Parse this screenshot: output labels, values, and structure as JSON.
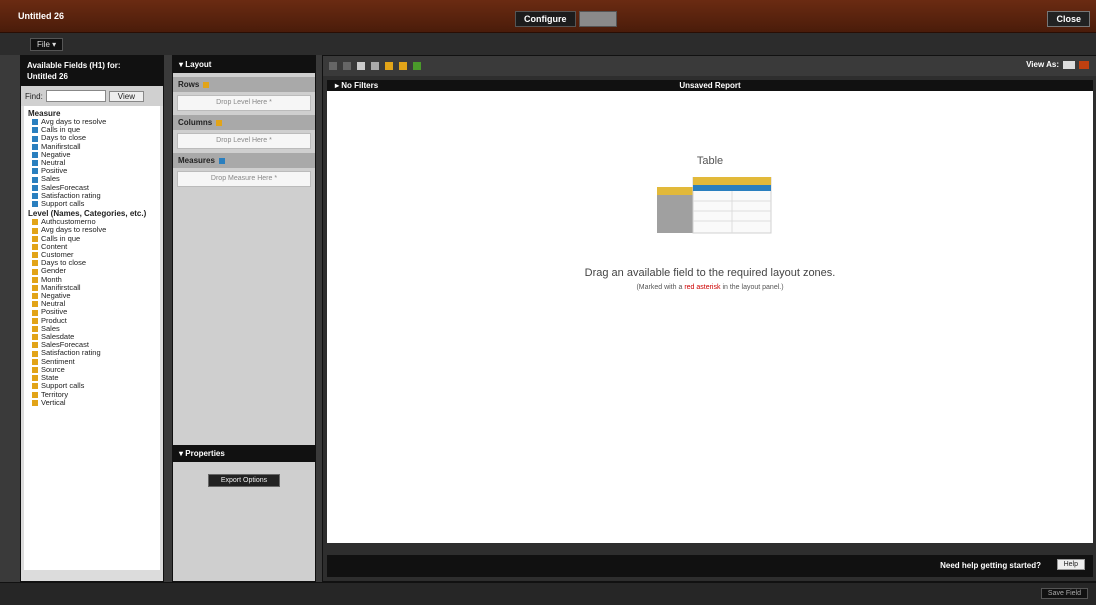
{
  "window": {
    "title": "Untitled 26",
    "close_label": "Close"
  },
  "mode_tabs": [
    {
      "label": "Configure"
    },
    {
      "label": ""
    }
  ],
  "file_button": "File ▾",
  "fields_panel": {
    "header_line1": "Available Fields (H1) for:",
    "header_line2": "Untitled 26",
    "find_label": "Find:",
    "find_placeholder": "",
    "view_label": "View",
    "groups": [
      {
        "name": "Measure",
        "icon": "measure-icon",
        "items": [
          "Avg days to resolve",
          "Calls in que",
          "Days to close",
          "Manifirstcall",
          "Negative",
          "Neutral",
          "Positive",
          "Sales",
          "SalesForecast",
          "Satisfaction rating",
          "Support calls"
        ]
      },
      {
        "name": "Level (Names, Categories, etc.)",
        "icon": "level-icon",
        "items": [
          "Authcustomerno",
          "Avg days to resolve",
          "Calls in que",
          "Content",
          "Customer",
          "Days to close",
          "Gender",
          "Month",
          "Manifirstcall",
          "Negative",
          "Neutral",
          "Positive",
          "Product",
          "Sales",
          "Salesdate",
          "SalesForecast",
          "Satisfaction rating",
          "Sentiment",
          "Source",
          "State",
          "Support calls",
          "Territory",
          "Vertical"
        ]
      }
    ]
  },
  "layout_panel": {
    "title": "Layout",
    "zones": [
      {
        "label": "Rows",
        "placeholder": "Drop Level Here *"
      },
      {
        "label": "Columns",
        "placeholder": "Drop Level Here *"
      },
      {
        "label": "Measures",
        "placeholder": "Drop Measure Here *"
      }
    ],
    "properties_title": "Properties",
    "export_label": "Export Options"
  },
  "main": {
    "view_as_label": "View As:",
    "filters_label": "No Filters",
    "report_name": "Unsaved Report",
    "canvas_title": "Table",
    "message": "Drag an available field to the required layout zones.",
    "sub_prefix": "(Marked with a ",
    "sub_highlight": "red asterisk",
    "sub_suffix": " in the layout panel.)",
    "help_text": "Need help getting started?",
    "help_button": "Help"
  },
  "footer": {
    "button": "Save Field"
  },
  "colors": {
    "accent": "#6b2b12",
    "level": "#e2a418",
    "measure": "#2a7fbf",
    "asterisk": "#c00000"
  }
}
